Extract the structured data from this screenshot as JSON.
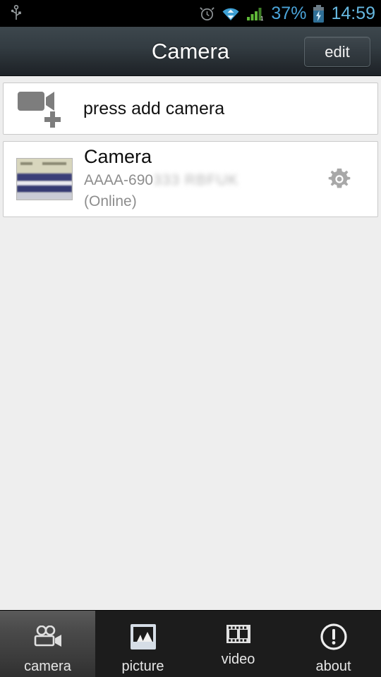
{
  "status_bar": {
    "usb_icon": "usb-icon",
    "alarm_icon": "alarm-clock-icon",
    "wifi_icon": "wifi-icon",
    "signal_icon": "cellular-signal-icon",
    "battery_percent": "37%",
    "battery_icon": "battery-charging-icon",
    "time": "14:59",
    "accent_color": "#4aa3d8"
  },
  "title_bar": {
    "title": "Camera",
    "edit_label": "edit"
  },
  "list": {
    "add_row": {
      "label": "press add camera",
      "icon": "add-camera-icon"
    },
    "cameras": [
      {
        "name": "Camera",
        "id_visible": "AAAA-690",
        "id_redacted": "333 RBFUK",
        "status": "(Online)",
        "settings_icon": "gear-icon",
        "thumbnail": "camera-snapshot-thumbnail"
      }
    ]
  },
  "tab_bar": {
    "active": "camera",
    "tabs": [
      {
        "key": "camera",
        "label": "camera",
        "icon": "movie-camera-icon"
      },
      {
        "key": "picture",
        "label": "picture",
        "icon": "photo-icon"
      },
      {
        "key": "video",
        "label": "video",
        "icon": "film-strip-icon"
      },
      {
        "key": "about",
        "label": "about",
        "icon": "exclamation-circle-icon"
      }
    ]
  }
}
